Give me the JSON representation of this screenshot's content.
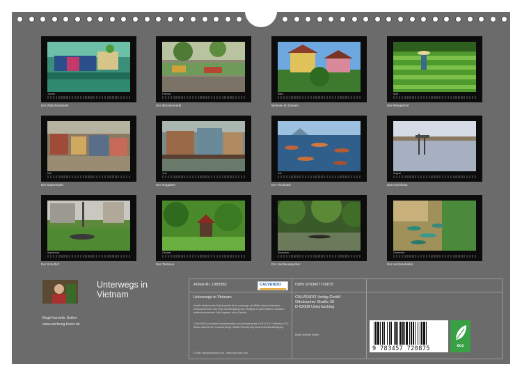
{
  "calendar": {
    "title_line1": "Unterwegs in",
    "title_line2": "Vietnam",
    "author": "Birgit Harriette Seifert",
    "website": "www.werbung-kunst.de"
  },
  "tiles": [
    {
      "caption": "Der Wäscheständer",
      "month": "Januar",
      "scene": "laundry"
    },
    {
      "caption": "Der Wochenmarkt",
      "month": "Februar",
      "scene": "market"
    },
    {
      "caption": "Wohnen im Grünen",
      "month": "März",
      "scene": "house"
    },
    {
      "caption": "Der Reisgärtner",
      "month": "April",
      "scene": "rice"
    },
    {
      "caption": "Der Supermarkt",
      "month": "Mai",
      "scene": "supermarket"
    },
    {
      "caption": "Der Vorgarten",
      "month": "Juni",
      "scene": "stilts"
    },
    {
      "caption": "Der Fischpark",
      "month": "Juli",
      "scene": "boats"
    },
    {
      "caption": "Das Hochhaus",
      "month": "August",
      "scene": "lagoon"
    },
    {
      "caption": "Der Schulhof",
      "month": "September",
      "scene": "school"
    },
    {
      "caption": "Das Teehaus",
      "month": "Oktober",
      "scene": "teahouse"
    },
    {
      "caption": "Der Hochseesportler",
      "month": "November",
      "scene": "river"
    },
    {
      "caption": "Der Hochseehafen",
      "month": "Dezember",
      "scene": "harbour"
    }
  ],
  "info": {
    "article_label": "Artikel-Nr. 1985982",
    "publisher_logo": "CALVENDO",
    "title": "Unterwegs in Vietnam",
    "isbn": "ISBN 9783457720875",
    "publisher_line1": "CALVENDO Verlag GmbH",
    "publisher_line2": "Ottobrunner Straße 39",
    "publisher_line3": "D-82008 Unterhaching",
    "author_small": "Birgit Harriette Seifert",
    "fine_print_1": "Inhalte bestehender Schutzrechte ist es untersagt, die Bilder dieses Kalenders herauszutrennen und ohne Genehmigung des Verlages zu gewerblichen Zwecken weiterzuverwenden. Alle Angaben ohne Gewähr.",
    "fine_print_2": "CALVENDO produziert klimafreundlich und klimabewusst in DE & EU. Positivere CO2-Bilanz dank kurzer Transportwege. Abfall-Reduzierung dank Einzelstückfertigung.",
    "contact": "E-Mail: info@calvendo.com · www.calvendo.com",
    "barcode_digits": "9 783457 720875",
    "eco_label": "eco"
  },
  "colors": {
    "background": "#6b6b6b",
    "frame": "#0c0c0c",
    "eco_green": "#39a046"
  }
}
